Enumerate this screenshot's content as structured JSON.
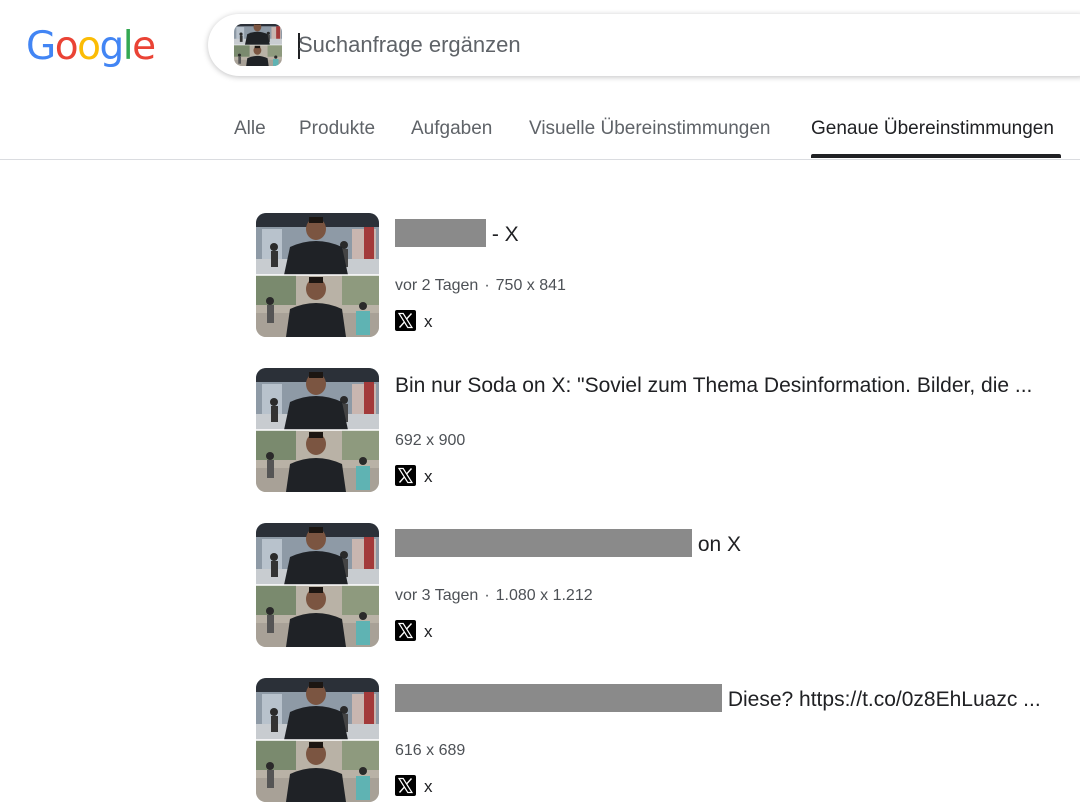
{
  "logo": {
    "letters": [
      "G",
      "o",
      "o",
      "g",
      "l",
      "e"
    ],
    "colors": [
      "#4285F4",
      "#EA4335",
      "#FBBC05",
      "#4285F4",
      "#34A853",
      "#EA4335"
    ]
  },
  "search": {
    "placeholder": "Suchanfrage ergänzen",
    "value": ""
  },
  "tabs": [
    {
      "label": "Alle",
      "active": false
    },
    {
      "label": "Produkte",
      "active": false
    },
    {
      "label": "Aufgaben",
      "active": false
    },
    {
      "label": "Visuelle Übereinstimmungen",
      "active": false
    },
    {
      "label": "Genaue Übereinstimmungen",
      "active": true
    }
  ],
  "results": [
    {
      "title_suffix": " - X",
      "date": "vor 2 Tagen",
      "dims": "750 x 841",
      "source": "x"
    },
    {
      "title": "Bin nur Soda on X: \"Soviel zum Thema Desinformation. Bilder, die ...",
      "dims": "692 x 900",
      "source": "x"
    },
    {
      "title_suffix": " on X",
      "date": "vor 3 Tagen",
      "dims": "1.080 x 1.212",
      "source": "x"
    },
    {
      "title_suffix": " Diese? https://t.co/0z8EhLuazc ...",
      "dims": "616 x 689",
      "source": "x"
    }
  ],
  "colors": {
    "text": "#202124",
    "secondary": "#5f6368",
    "meta": "#4d5156",
    "redaction": "#8a8a8a"
  }
}
